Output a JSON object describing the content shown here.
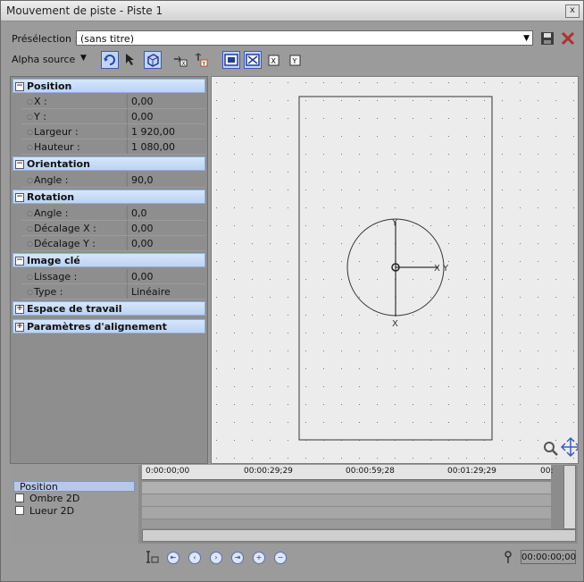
{
  "window": {
    "title": "Mouvement de piste - Piste 1",
    "close": "x"
  },
  "preset": {
    "label": "Présélection :",
    "value": "(sans titre)"
  },
  "toolbar": {
    "alpha_source": "Alpha source"
  },
  "properties": {
    "sections": [
      {
        "title": "Position",
        "rows": [
          {
            "key": "X :",
            "val": "0,00"
          },
          {
            "key": "Y :",
            "val": "0,00"
          },
          {
            "key": "Largeur :",
            "val": "1 920,00"
          },
          {
            "key": "Hauteur :",
            "val": "1 080,00"
          }
        ]
      },
      {
        "title": "Orientation",
        "rows": [
          {
            "key": "Angle :",
            "val": "90,0"
          }
        ]
      },
      {
        "title": "Rotation",
        "rows": [
          {
            "key": "Angle :",
            "val": "0,0"
          },
          {
            "key": "Décalage X :",
            "val": "0,00"
          },
          {
            "key": "Décalage Y :",
            "val": "0,00"
          }
        ]
      },
      {
        "title": "Image clé",
        "rows": [
          {
            "key": "Lissage :",
            "val": "0,00"
          },
          {
            "key": "Type :",
            "val": "Linéaire"
          }
        ]
      },
      {
        "title": "Espace de travail",
        "rows": []
      },
      {
        "title": "Paramètres d'alignement",
        "rows": []
      }
    ]
  },
  "canvas": {
    "axis_y_top": "Y",
    "axis_x_bottom": "X",
    "axis_xy_right": "X Y"
  },
  "timeline": {
    "tracks": [
      "Position",
      "Ombre 2D",
      "Lueur 2D"
    ],
    "ruler_ticks": [
      "0:00:00;00",
      "00:00:29;29",
      "00:00:59;28",
      "00:01:29;29",
      "00:"
    ],
    "current_time": "00:00:00;00"
  }
}
